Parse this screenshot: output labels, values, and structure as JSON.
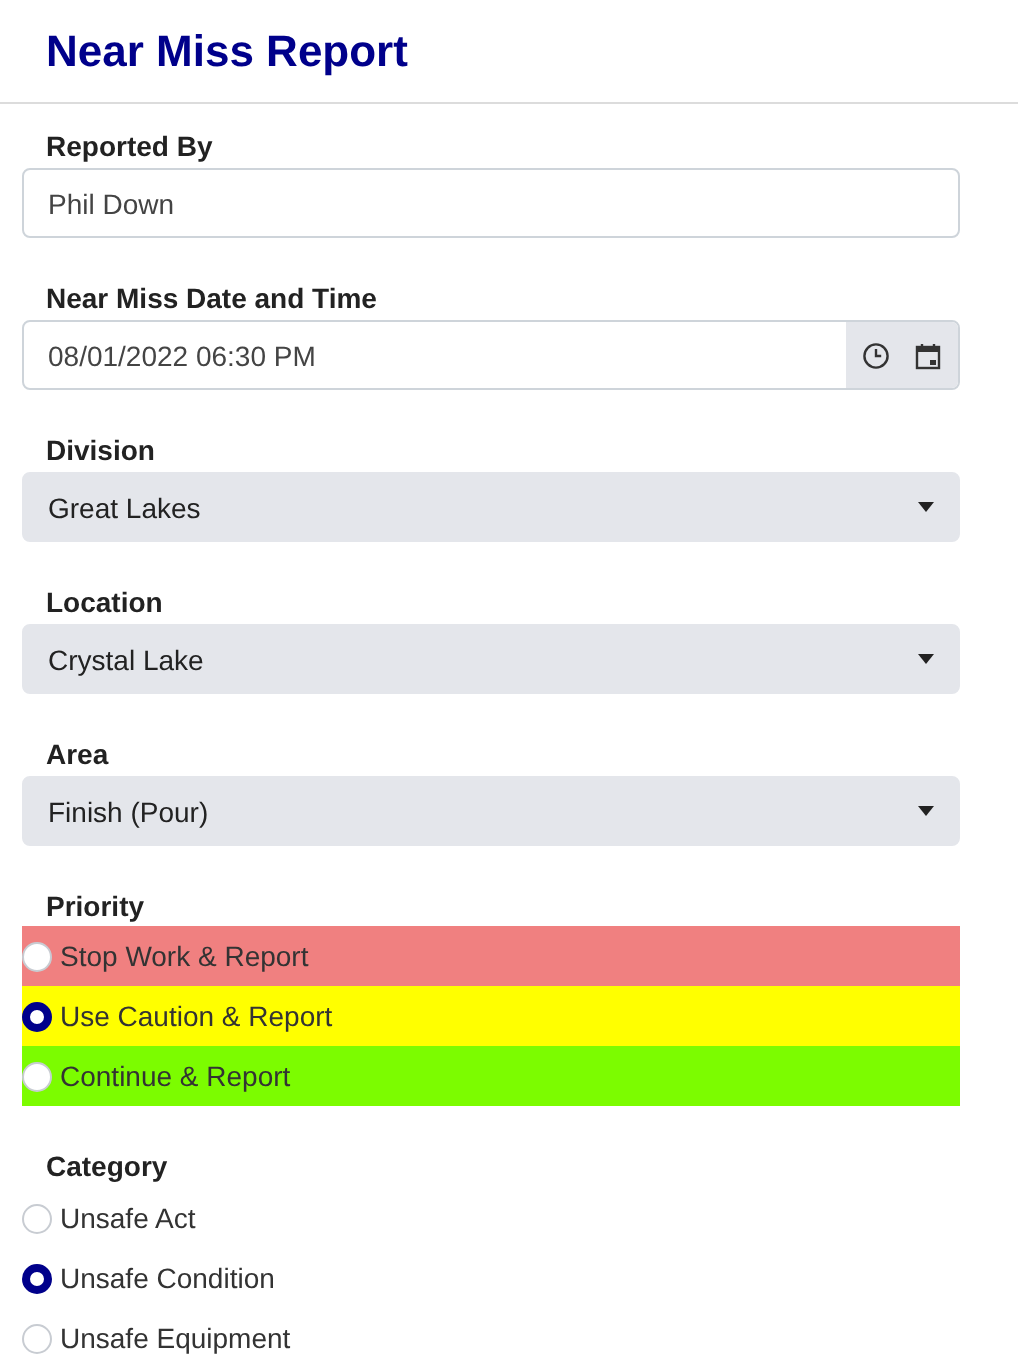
{
  "title": "Near Miss Report",
  "fields": [
    {
      "kind": "text",
      "label": "Reported By",
      "value": "Phil Down"
    },
    {
      "kind": "datetime",
      "label": "Near Miss Date and Time",
      "value": "08/01/2022 06:30 PM"
    },
    {
      "kind": "select",
      "label": "Division",
      "value": "Great Lakes"
    },
    {
      "kind": "select",
      "label": "Location",
      "value": "Crystal Lake"
    },
    {
      "kind": "select",
      "label": "Area",
      "value": "Finish (Pour)"
    }
  ],
  "priority": {
    "label": "Priority",
    "options": [
      {
        "label": "Stop Work & Report",
        "selected": false,
        "color": "#f08080"
      },
      {
        "label": "Use Caution & Report",
        "selected": true,
        "color": "#ffff00"
      },
      {
        "label": "Continue & Report",
        "selected": false,
        "color": "#7cfc00"
      }
    ]
  },
  "category": {
    "label": "Category",
    "options": [
      {
        "label": "Unsafe Act",
        "selected": false
      },
      {
        "label": "Unsafe Condition",
        "selected": true
      },
      {
        "label": "Unsafe Equipment",
        "selected": false
      }
    ]
  }
}
